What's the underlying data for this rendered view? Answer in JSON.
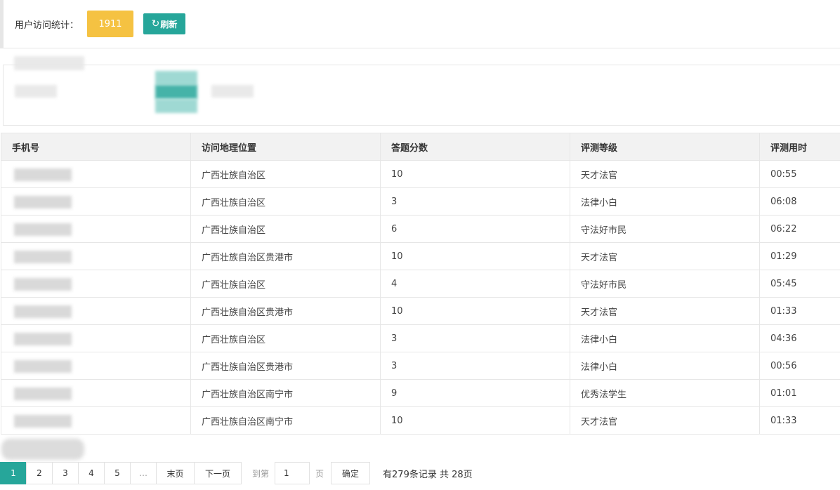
{
  "header": {
    "stat_label": "用户访问统计：",
    "stat_value": "1911",
    "refresh_label": "刷新",
    "refresh_icon": "refresh-icon"
  },
  "table": {
    "columns": [
      "手机号",
      "访问地理位置",
      "答题分数",
      "评测等级",
      "评测用时"
    ],
    "rows": [
      {
        "location": "广西壮族自治区",
        "score": "10",
        "level": "天才法官",
        "time": "00:55"
      },
      {
        "location": "广西壮族自治区",
        "score": "3",
        "level": "法律小白",
        "time": "06:08"
      },
      {
        "location": "广西壮族自治区",
        "score": "6",
        "level": "守法好市民",
        "time": "06:22"
      },
      {
        "location": "广西壮族自治区贵港市",
        "score": "10",
        "level": "天才法官",
        "time": "01:29"
      },
      {
        "location": "广西壮族自治区",
        "score": "4",
        "level": "守法好市民",
        "time": "05:45"
      },
      {
        "location": "广西壮族自治区贵港市",
        "score": "10",
        "level": "天才法官",
        "time": "01:33"
      },
      {
        "location": "广西壮族自治区",
        "score": "3",
        "level": "法律小白",
        "time": "04:36"
      },
      {
        "location": "广西壮族自治区贵港市",
        "score": "3",
        "level": "法律小白",
        "time": "00:56"
      },
      {
        "location": "广西壮族自治区南宁市",
        "score": "9",
        "level": "优秀法学生",
        "time": "01:01"
      },
      {
        "location": "广西壮族自治区南宁市",
        "score": "10",
        "level": "天才法官",
        "time": "01:33"
      }
    ]
  },
  "pagination": {
    "pages": [
      "1",
      "2",
      "3",
      "4",
      "5"
    ],
    "current": "1",
    "ellipsis": "…",
    "last_label": "末页",
    "next_label": "下一页",
    "goto_label": "到第",
    "goto_value": "1",
    "page_unit": "页",
    "confirm_label": "确定",
    "summary": "有279条记录 共 28页"
  },
  "colors": {
    "accent": "#26a69a",
    "badge": "#f5c242"
  }
}
